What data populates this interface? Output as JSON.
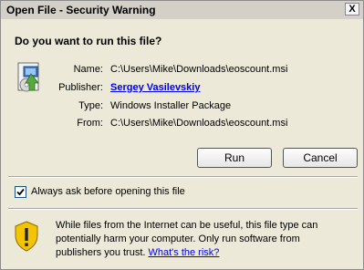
{
  "window": {
    "title": "Open File - Security Warning",
    "close_glyph": "X"
  },
  "prompt": {
    "question": "Do you want to run this file?"
  },
  "file_info": {
    "name_label": "Name:",
    "name_value": "C:\\Users\\Mike\\Downloads\\eoscount.msi",
    "publisher_label": "Publisher:",
    "publisher_value": "Sergey Vasilevskiy",
    "type_label": "Type:",
    "type_value": "Windows Installer Package",
    "from_label": "From:",
    "from_value": "C:\\Users\\Mike\\Downloads\\eoscount.msi"
  },
  "buttons": {
    "run_label": "Run",
    "cancel_label": "Cancel"
  },
  "option": {
    "always_ask_label": "Always ask before opening this file",
    "always_ask_checked": true
  },
  "warning": {
    "text": "While files from the Internet can be useful, this file type can potentially harm your computer. Only run software from publishers you trust.",
    "link_label": "What's the risk?"
  },
  "icons": {
    "file": "installer-package-icon",
    "shield": "warning-shield-icon"
  },
  "colors": {
    "link": "#0000ee",
    "shield_yellow": "#f5c400"
  }
}
